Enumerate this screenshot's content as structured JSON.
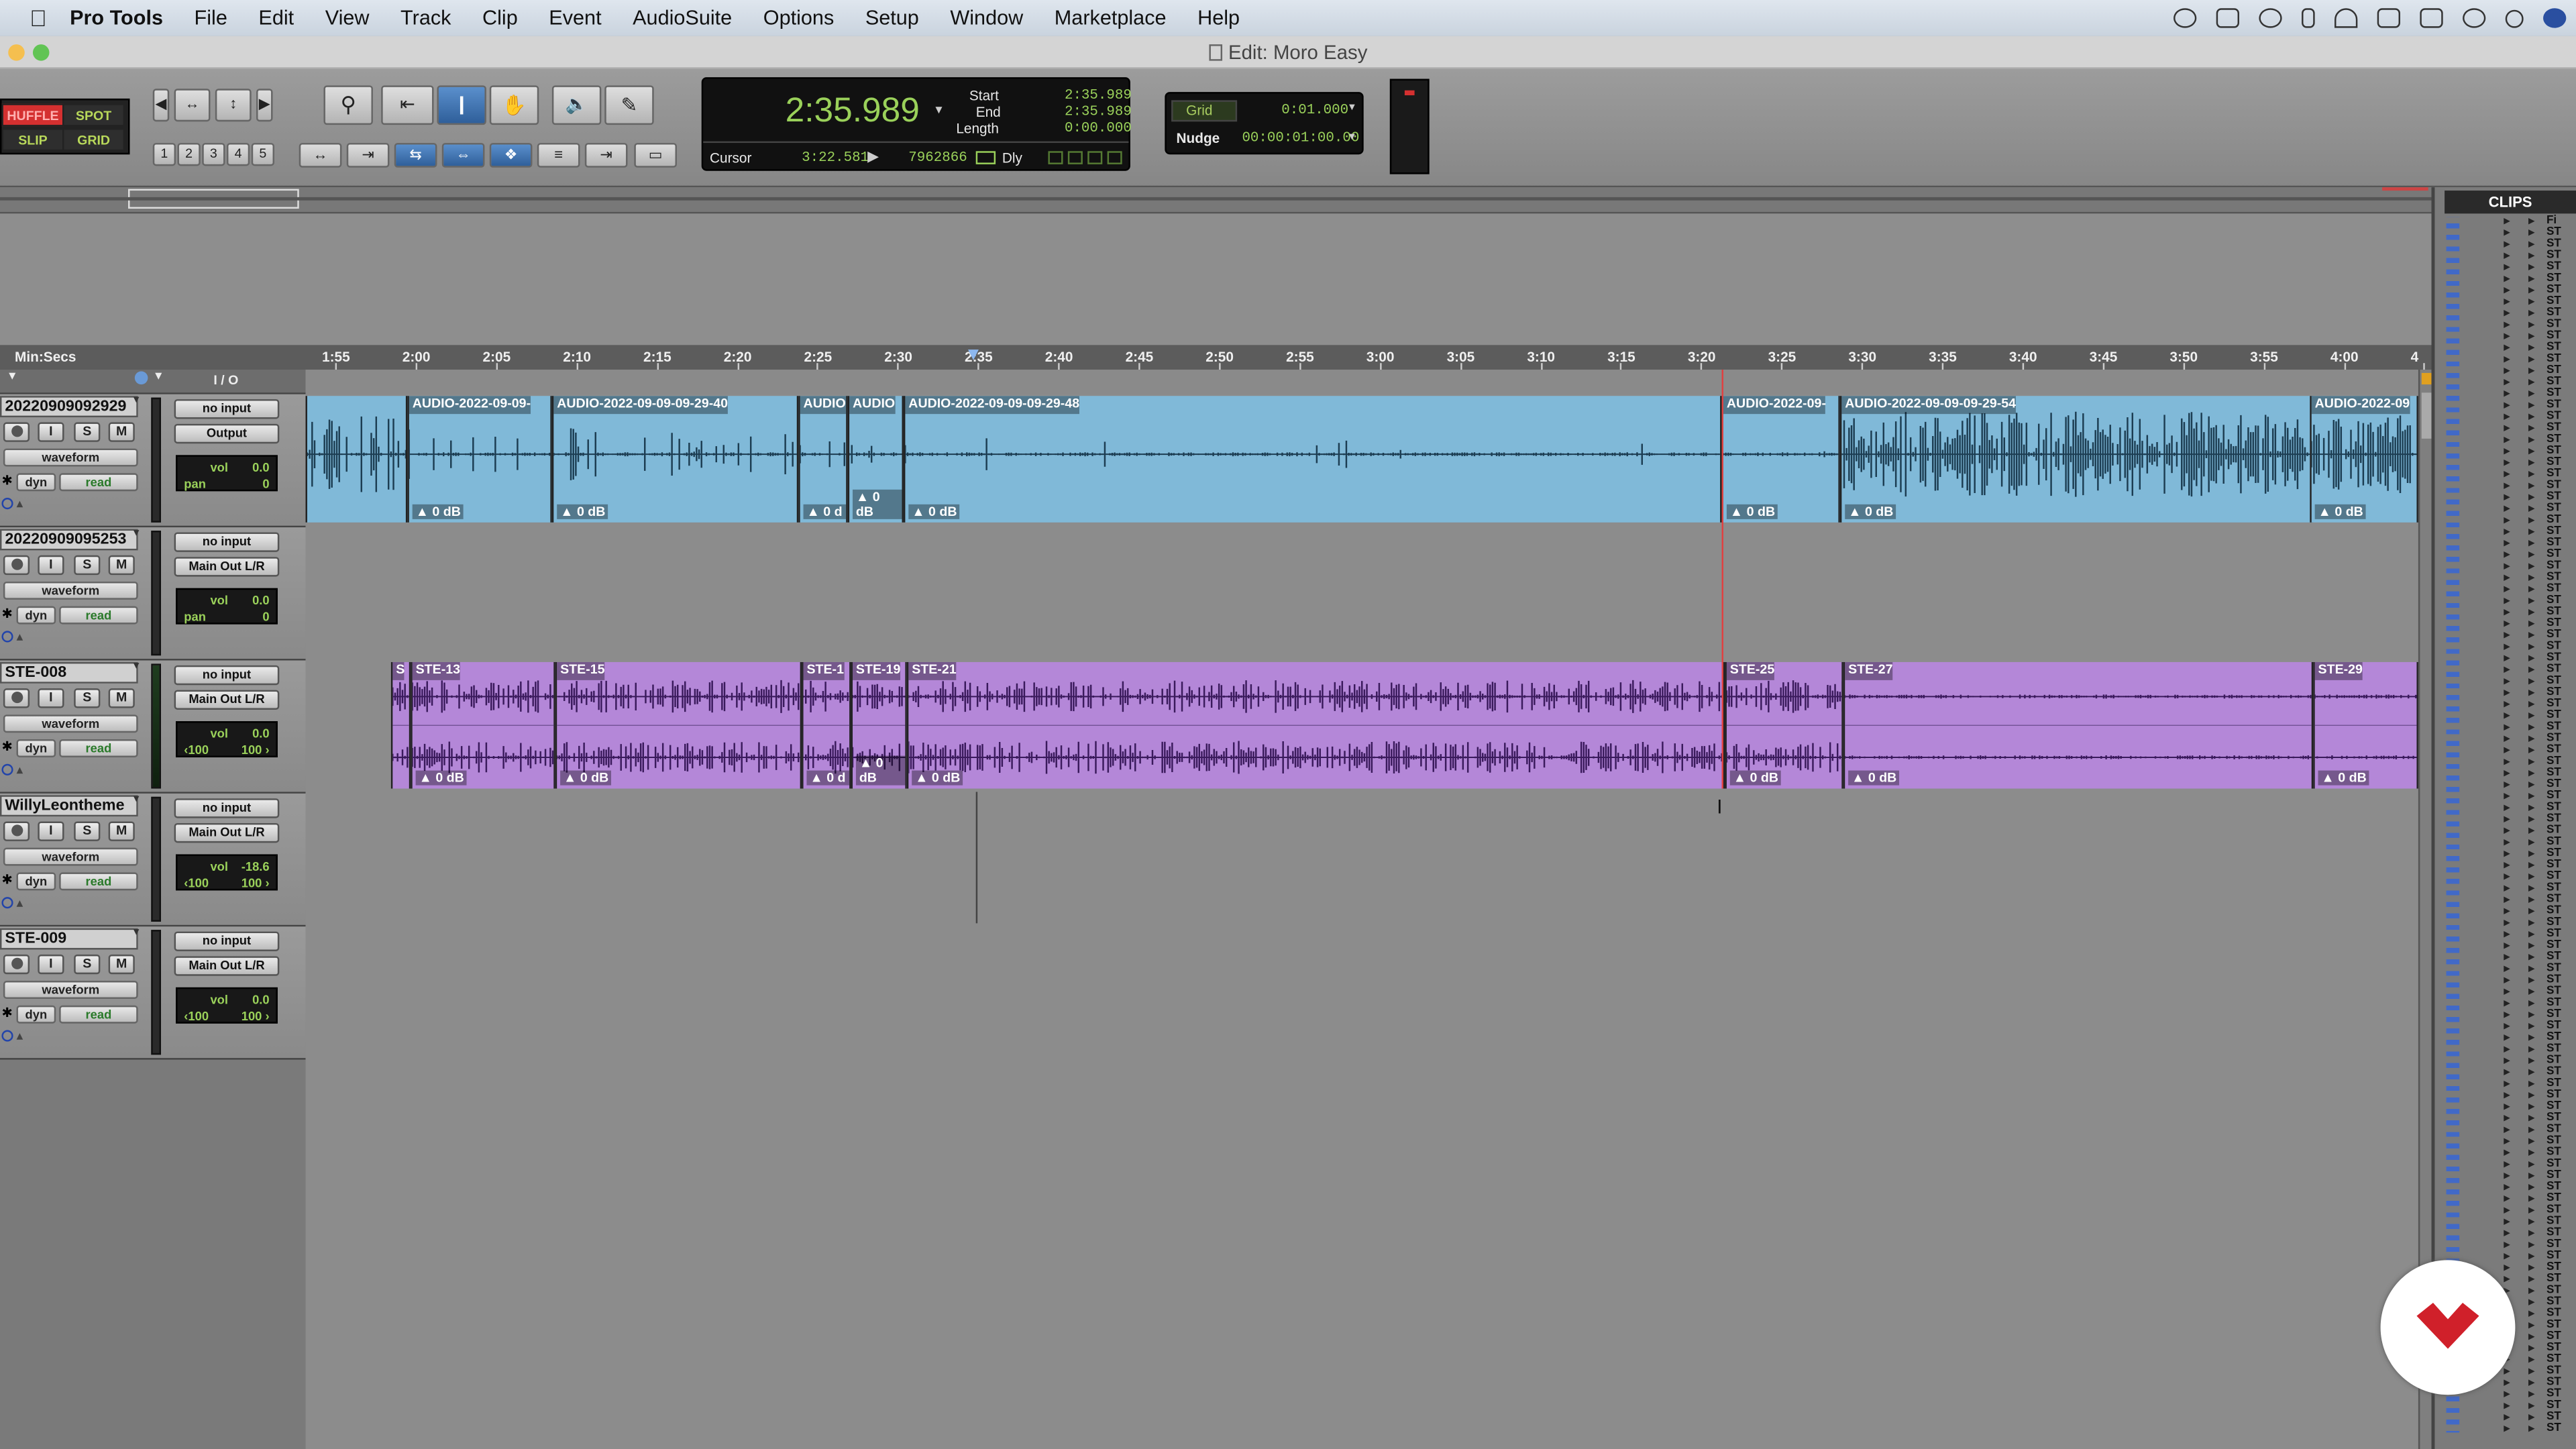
{
  "menu": {
    "app": "Pro Tools",
    "items": [
      "File",
      "Edit",
      "View",
      "Track",
      "Clip",
      "Event",
      "AudioSuite",
      "Options",
      "Setup",
      "Window",
      "Marketplace",
      "Help"
    ]
  },
  "window": {
    "title": "Edit: Moro Easy"
  },
  "toolbar": {
    "modes": {
      "shuffle": "HUFFLE",
      "spot": "SPOT",
      "slip": "SLIP",
      "grid": "GRID"
    },
    "zoom_presets": [
      "1",
      "2",
      "3",
      "4",
      "5"
    ],
    "counter": {
      "main": "2:35.989",
      "start_label": "Start",
      "start": "2:35.989",
      "end_label": "End",
      "end": "2:35.989",
      "length_label": "Length",
      "length": "0:00.000",
      "cursor_label": "Cursor",
      "cursor": "3:22.581",
      "samples": "7962866",
      "dly": "Dly"
    },
    "grid": {
      "label": "Grid",
      "value": "0:01.000"
    },
    "nudge": {
      "label": "Nudge",
      "value": "00:00:01:00.00"
    }
  },
  "ruler": {
    "label": "Min:Secs",
    "ticks": [
      "1:55",
      "2:00",
      "2:05",
      "2:10",
      "2:15",
      "2:20",
      "2:25",
      "2:30",
      "2:35",
      "2:40",
      "2:45",
      "2:50",
      "2:55",
      "3:00",
      "3:05",
      "3:10",
      "3:15",
      "3:20",
      "3:25",
      "3:30",
      "3:35",
      "3:40",
      "3:45",
      "3:50",
      "3:55",
      "4:00",
      "4"
    ]
  },
  "track_header": {
    "io_label": "I / O"
  },
  "tracks": [
    {
      "name": "20220909092929",
      "input": "no input",
      "output": "Output",
      "view": "waveform",
      "dyn": "dyn",
      "auto": "read",
      "vol_label": "vol",
      "vol": "0.0",
      "pan_label": "pan",
      "pan": "0",
      "pan_right": ""
    },
    {
      "name": "20220909095253",
      "input": "no input",
      "output": "Main Out L/R",
      "view": "waveform",
      "dyn": "dyn",
      "auto": "read",
      "vol_label": "vol",
      "vol": "0.0",
      "pan_label": "pan",
      "pan": "0",
      "pan_right": ""
    },
    {
      "name": "STE-008",
      "input": "no input",
      "output": "Main Out L/R",
      "view": "waveform",
      "dyn": "dyn",
      "auto": "read",
      "vol_label": "vol",
      "vol": "0.0",
      "pan_label": "‹100",
      "pan": "",
      "pan_right": "100 ›"
    },
    {
      "name": "WillyLeontheme",
      "input": "no input",
      "output": "Main Out L/R",
      "view": "waveform",
      "dyn": "dyn",
      "auto": "read",
      "vol_label": "vol",
      "vol": "-18.6",
      "pan_label": "‹100",
      "pan": "",
      "pan_right": "100 ›"
    },
    {
      "name": "STE-009",
      "input": "no input",
      "output": "Main Out L/R",
      "view": "waveform",
      "dyn": "dyn",
      "auto": "read",
      "vol_label": "vol",
      "vol": "0.0",
      "pan_label": "‹100",
      "pan": "",
      "pan_right": "100 ›"
    }
  ],
  "clips_track1": [
    {
      "name": "AUDIO-2022-09-09-",
      "gain": "0 dB"
    },
    {
      "name": "AUDIO-2022-09-09-09-29-40",
      "gain": "0 dB"
    },
    {
      "name": "AUDIO",
      "gain": "0 d"
    },
    {
      "name": "AUDIO",
      "gain": "0 dB"
    },
    {
      "name": "AUDIO-2022-09-09-09-29-48",
      "gain": "0 dB"
    },
    {
      "name": "AUDIO-2022-09-",
      "gain": "0 dB"
    },
    {
      "name": "AUDIO-2022-09-09-09-29-54",
      "gain": "0 dB"
    },
    {
      "name": "AUDIO-2022-09",
      "gain": "0 dB"
    }
  ],
  "clips_track3": [
    {
      "name": "S",
      "gain": ""
    },
    {
      "name": "STE-13",
      "gain": "0 dB"
    },
    {
      "name": "STE-15",
      "gain": "0 dB"
    },
    {
      "name": "STE-1",
      "gain": "0 d"
    },
    {
      "name": "STE-19",
      "gain": "0 dB"
    },
    {
      "name": "STE-21",
      "gain": "0 dB"
    },
    {
      "name": "STE-25",
      "gain": "0 dB"
    },
    {
      "name": "STE-27",
      "gain": "0 dB"
    },
    {
      "name": "STE-29",
      "gain": "0 dB"
    }
  ],
  "clips_panel": {
    "title": "CLIPS",
    "top_entry": "Fi",
    "entry": "ST"
  },
  "colors": {
    "audio_clip": "#80b9d8",
    "ste_clip": "#b487d8",
    "lcd_text": "#9ad15a"
  }
}
